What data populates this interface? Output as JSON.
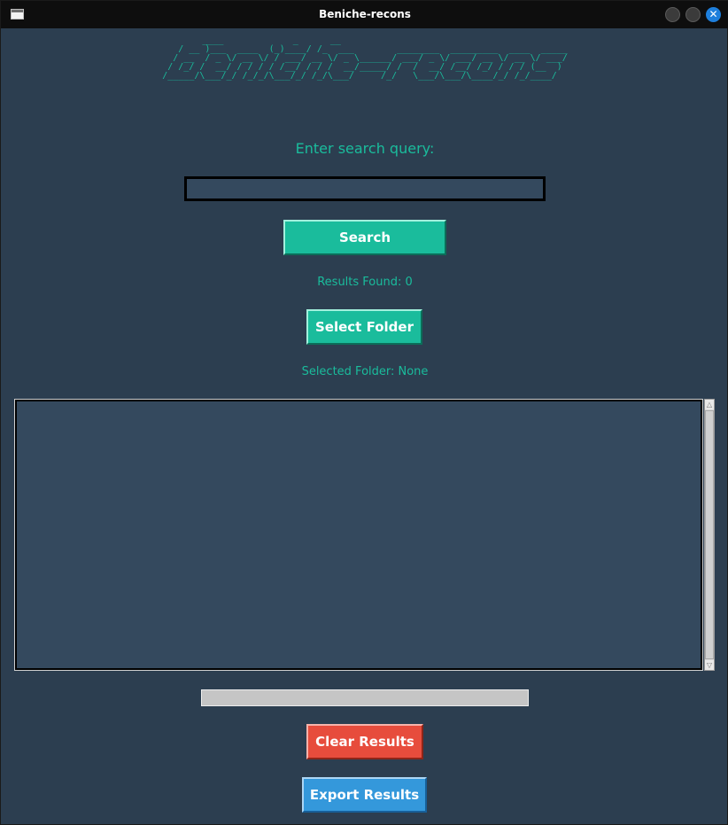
{
  "window": {
    "title": "Beniche-recons",
    "close_glyph": "✕"
  },
  "logo": {
    "ascii_art": "    ____             _      __                                       \n   / __ )___  ____  (_)____/ /_  ___        ________  _________  ____  _____\n  / __  / _ \\/ __ \\/ / ___/ __ \\/ _ \\______/ ___/ _ \\/ ___/ __ \\/ __ \\/ ___/\n / /_/ /  __/ / / / / /__/ / / /  __/_____/ /  /  __/ /__/ /_/ / / / (__  ) \n/_____/\\___/_/ /_/_/\\___/_/ /_/\\___/     /_/   \\___/\\___/\\____/_/ /_/____/  "
  },
  "search": {
    "label": "Enter search query:",
    "value": "",
    "placeholder": "",
    "button_label": "Search"
  },
  "results": {
    "count_text": "Results Found: 0",
    "text": ""
  },
  "folder": {
    "button_label": "Select Folder",
    "selected_text": "Selected Folder: None"
  },
  "progress": {
    "value": 0
  },
  "actions": {
    "clear_label": "Clear Results",
    "export_label": "Export Results"
  },
  "scrollbar": {
    "up_glyph": "△",
    "down_glyph": "▽"
  },
  "colors": {
    "background": "#2c3e50",
    "accent": "#1abc9c",
    "input_bg": "#34495e",
    "danger": "#e74c3c",
    "primary": "#3498db"
  }
}
